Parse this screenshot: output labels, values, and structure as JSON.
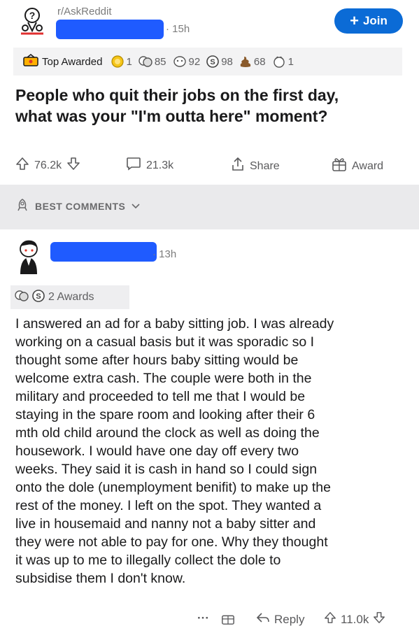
{
  "post": {
    "subreddit": "r/AskReddit",
    "time": "· 15h",
    "join_label": "Join",
    "award_bar": {
      "label": "Top Awarded",
      "awards": [
        {
          "icon": "gold-award-icon",
          "count": "1"
        },
        {
          "icon": "wholesome-award-icon",
          "count": "85"
        },
        {
          "icon": "helpful-award-icon",
          "count": "92"
        },
        {
          "icon": "silver-coin-award-icon",
          "count": "98"
        },
        {
          "icon": "poop-award-icon",
          "count": "68"
        },
        {
          "icon": "hugz-award-icon",
          "count": "1"
        }
      ]
    },
    "title_lines": [
      "People who quit their jobs on the first day,",
      "what was your \"I'm outta here\" moment?"
    ],
    "actions": {
      "upvotes": "76.2k",
      "comments": "21.3k",
      "share": "Share",
      "award": "Award"
    }
  },
  "comments_header": {
    "sort_label": "BEST COMMENTS"
  },
  "comment": {
    "time": "· 13h",
    "awards_label": "2 Awards",
    "body_lines": [
      "I answered an ad for a baby sitting job. I was already",
      "working on a casual basis  but it was sporadic so I",
      "thought some after hours baby sitting would be",
      "welcome extra cash. The couple were both in the",
      "military and proceeded to tell me that I would be",
      "staying in the spare room and looking after their 6",
      "mth old child around the clock as well as doing the",
      "housework.  I would have one day off every two",
      "weeks.  They said it is cash in hand so I could sign",
      "onto the dole (unemployment benifit) to make up the",
      "rest of the money. I left on the spot. They wanted a",
      "live in housemaid and nanny not a baby sitter and",
      "they were not able to pay for one. Why they thought",
      "it was up to me to illegally collect the dole to",
      "subsidise them I don't know."
    ],
    "footer": {
      "more": "···",
      "reply": "Reply",
      "votes": "11.0k"
    }
  },
  "colors": {
    "join_button": "#0b6bd6",
    "redaction": "#1f5bff",
    "award_bar_bg": "#f3f3f4",
    "section_bar_bg": "#eaeaec"
  }
}
